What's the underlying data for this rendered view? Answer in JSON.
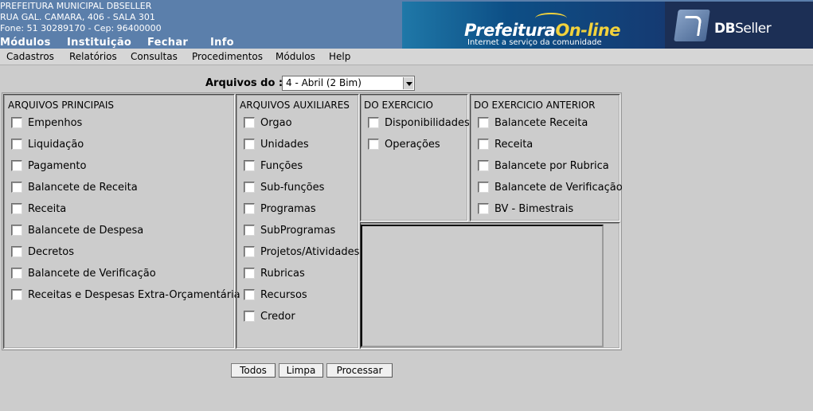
{
  "header": {
    "org_name": "PREFEITURA MUNICIPAL DBSELLER",
    "address": "RUA GAL. CAMARA, 406 - SALA 301",
    "contact": "Fone: 51 30289170  -  Cep: 96400000",
    "top_menu": [
      "Módulos",
      "Instituição",
      "Fechar",
      "Info"
    ],
    "banner_title_a": "Prefeitura",
    "banner_title_b": "On-line",
    "banner_subtitle": "Internet a serviço da comunidade",
    "brand_a": "DB",
    "brand_b": "Seller"
  },
  "menubar": [
    "Cadastros",
    "Relatórios",
    "Consultas",
    "Procedimentos",
    "Módulos",
    "Help"
  ],
  "form": {
    "arquivos_label": "Arquivos do :",
    "arquivos_value": "4 - Abril (2 Bim)"
  },
  "panels": {
    "principais": {
      "title": "ARQUIVOS PRINCIPAIS",
      "items": [
        "Empenhos",
        "Liquidação",
        "Pagamento",
        "Balancete de Receita",
        "Receita",
        "Balancete de Despesa",
        "Decretos",
        "Balancete de Verificação",
        "Receitas e Despesas Extra-Orçamentária"
      ]
    },
    "auxiliares": {
      "title": "ARQUIVOS AUXILIARES",
      "items": [
        "Orgao",
        "Unidades",
        "Funções",
        "Sub-funções",
        "Programas",
        "SubProgramas",
        "Projetos/Atividades",
        "Rubricas",
        "Recursos",
        "Credor"
      ]
    },
    "exercicio": {
      "title": "DO EXERCICIO",
      "items": [
        "Disponibilidades",
        "Operações"
      ]
    },
    "anterior": {
      "title": "DO EXERCICIO ANTERIOR",
      "items": [
        "Balancete Receita",
        "Receita",
        "Balancete por Rubrica",
        "Balancete de Verificação",
        "BV - Bimestrais"
      ]
    }
  },
  "buttons": {
    "todos": "Todos",
    "limpa": "Limpa",
    "processar": "Processar"
  },
  "colors": {
    "header_bg": "#5b7fab",
    "page_bg": "#cccccc",
    "logo_accent": "#f2d23c"
  }
}
